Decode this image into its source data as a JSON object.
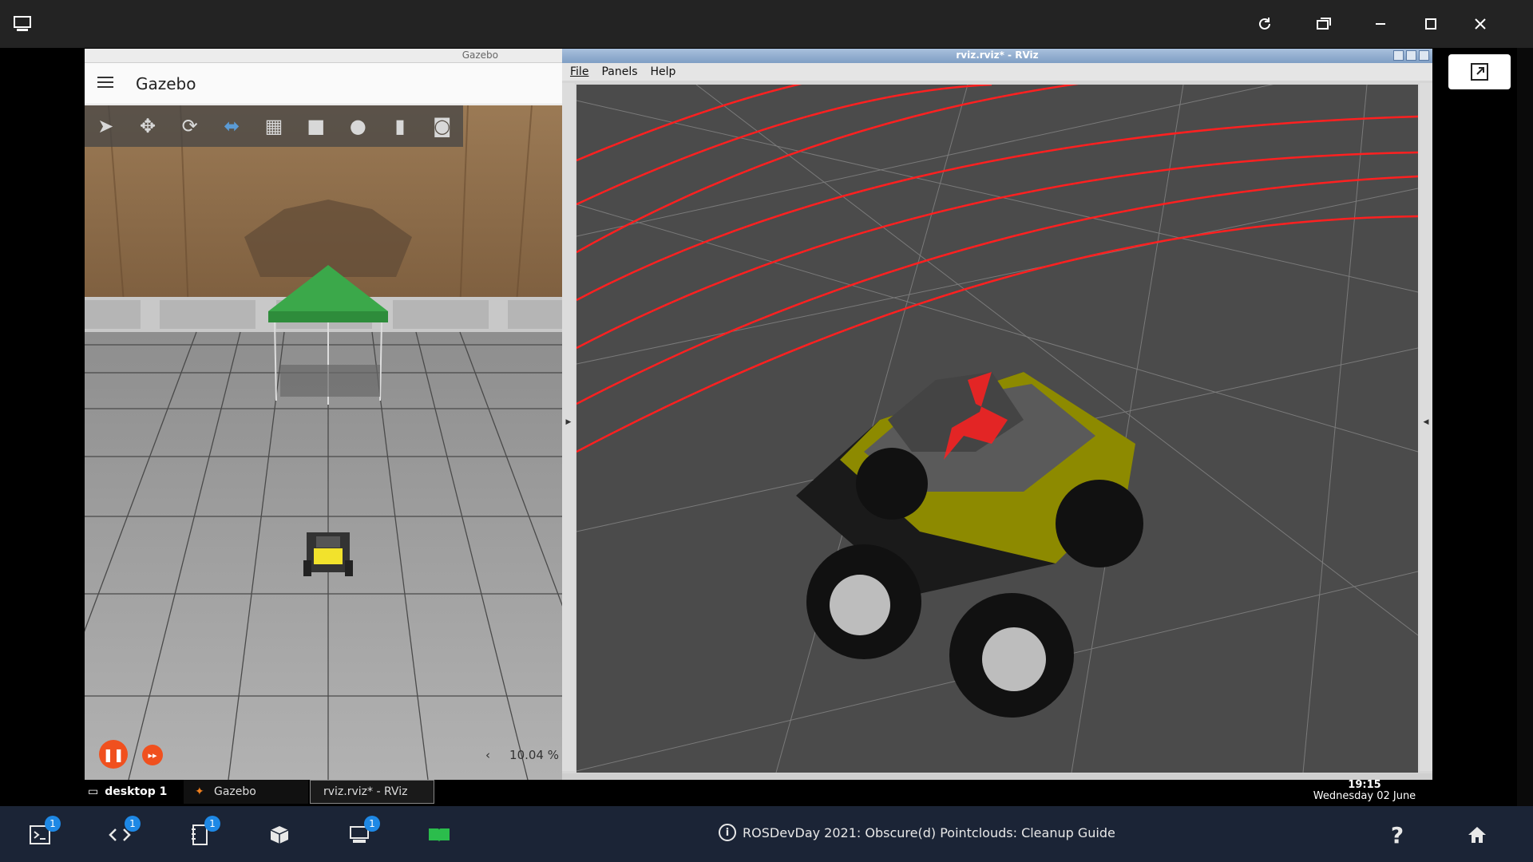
{
  "gazebo": {
    "window_title": "Gazebo",
    "app_title": "Gazebo",
    "toolbar": [
      "select-mode",
      "translate-mode",
      "rotate-mode",
      "scale-mode",
      "grid",
      "box",
      "sphere",
      "cylinder",
      "screenshot"
    ],
    "real_time_factor": "10.04 %",
    "rtf_arrow": "‹"
  },
  "rviz": {
    "window_title": "rviz.rviz* - RViz",
    "menu": {
      "file": "File",
      "panels": "Panels",
      "help": "Help"
    }
  },
  "taskbar": {
    "desktop": "desktop 1",
    "tasks": {
      "gazebo": "Gazebo",
      "rviz": "rviz.rviz* - RViz"
    },
    "time": "19:15",
    "date": "Wednesday 02 June"
  },
  "dock": {
    "message": "ROSDevDay 2021: Obscure(d) Pointclouds: Cleanup Guide",
    "badges": {
      "terminal": "1",
      "code": "1",
      "notebook": "1",
      "desktop": "1"
    }
  },
  "colors": {
    "accent": "#f0501e",
    "dock_bg": "#1b2436",
    "badge": "#1e88e5",
    "laser": "#ff2020"
  }
}
